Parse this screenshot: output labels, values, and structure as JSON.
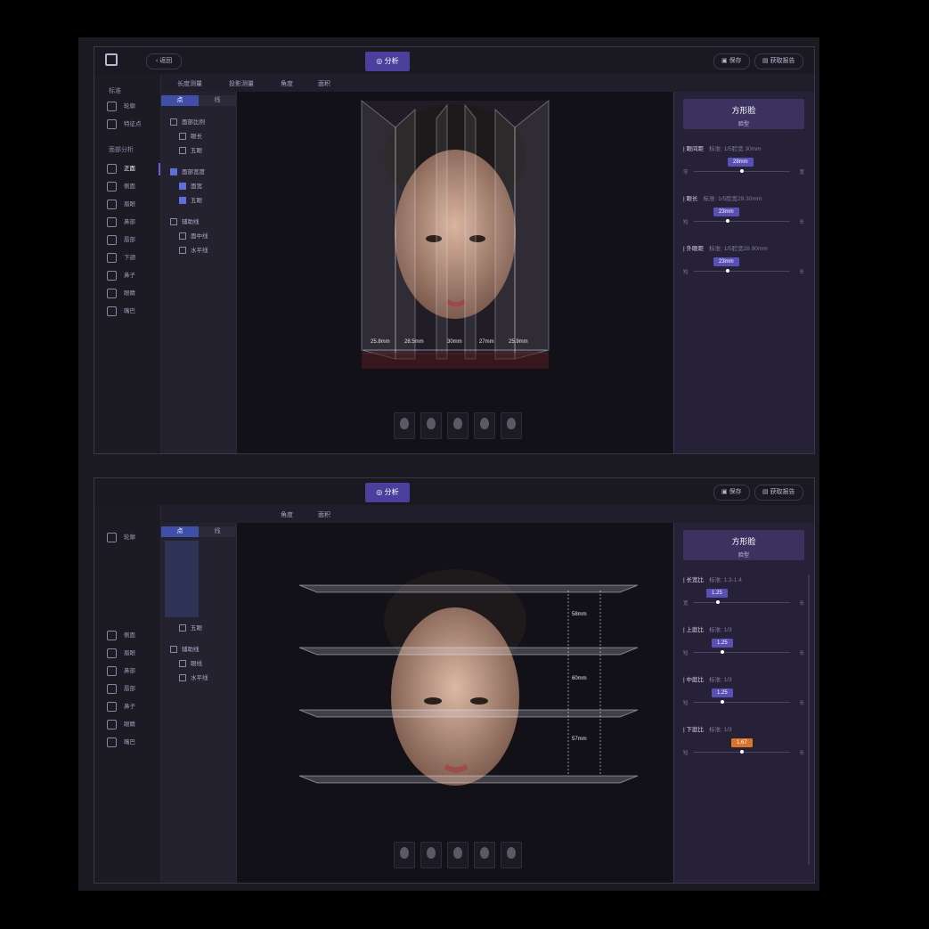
{
  "colors": {
    "accent": "#4a3f9a",
    "active_seg": "#3f4fa8",
    "warning": "#d8752a"
  },
  "top": {
    "back_label": "返回",
    "tabs": [
      {
        "label": "分析",
        "active": true
      },
      {
        "label": "",
        "active": false
      },
      {
        "label": "",
        "active": false
      },
      {
        "label": "",
        "active": false
      }
    ],
    "save_label": "保存",
    "report_label": "获取报告",
    "tools": [
      "长度测量",
      "投影测量",
      "角度",
      "面积"
    ],
    "nav_group_1": "标准",
    "nav_items_1": [
      "轮廓",
      "特征点"
    ],
    "nav_group_2": "面部分析",
    "nav_items_2": [
      "正面",
      "侧面",
      "眉眼",
      "鼻部",
      "唇部",
      "下颌",
      "鼻子",
      "眼睛",
      "嘴巴"
    ],
    "seg": [
      "点",
      "线"
    ],
    "options": [
      {
        "label": "面部比例",
        "checked": false
      },
      {
        "label": "眼长",
        "checked": false
      },
      {
        "label": "五眼",
        "checked": false
      },
      {
        "label": "面部宽度",
        "checked": true
      },
      {
        "label": "面宽",
        "checked": true
      },
      {
        "label": "五眼",
        "checked": true
      },
      {
        "label": "辅助线",
        "checked": false
      },
      {
        "label": "面中线",
        "checked": false
      },
      {
        "label": "水平线",
        "checked": false
      }
    ],
    "measures": [
      "25.8mm",
      "28.5mm",
      "30mm",
      "27mm",
      "25.9mm"
    ],
    "face_type": "方形脸",
    "face_sub": "脸型",
    "metrics": [
      {
        "label": "眼间距",
        "std": "标准: 1/5脸宽 30mm",
        "value": "28mm",
        "knob": 0.5,
        "lo": "窄",
        "hi": "宽"
      },
      {
        "label": "眼长",
        "std": "标准: 1/5脸宽29.30mm",
        "value": "23mm",
        "knob": 0.35,
        "lo": "短",
        "hi": "长"
      },
      {
        "label": "外眼距",
        "std": "标准: 1/5脸宽28.90mm",
        "value": "23mm",
        "knob": 0.35,
        "lo": "短",
        "hi": "长"
      }
    ]
  },
  "bottom": {
    "tabs": [
      {
        "label": "分析",
        "active": true
      },
      {
        "label": "",
        "active": false
      },
      {
        "label": "",
        "active": false
      },
      {
        "label": "",
        "active": false
      }
    ],
    "save_label": "保存",
    "report_label": "获取报告",
    "tools": [
      "角度",
      "面积"
    ],
    "nav_items": [
      "轮廓",
      "",
      "侧面",
      "眉眼",
      "鼻部",
      "唇部",
      "鼻子",
      "眼睛",
      "嘴巴"
    ],
    "seg": [
      "点",
      "线"
    ],
    "options": [
      {
        "label": "五眼",
        "checked": false
      },
      {
        "label": "辅助线",
        "checked": false
      },
      {
        "label": "眼线",
        "checked": false
      },
      {
        "label": "水平线",
        "checked": false
      }
    ],
    "measures": [
      "58mm",
      "60mm",
      "57mm"
    ],
    "face_type": "方形脸",
    "face_sub": "脸型",
    "metrics": [
      {
        "label": "长宽比",
        "std": "标准: 1.3-1.4",
        "value": "1.25",
        "knob": 0.25,
        "lo": "宽",
        "hi": "长",
        "warn": false
      },
      {
        "label": "上庭比",
        "std": "标准: 1/3",
        "value": "1.25",
        "knob": 0.3,
        "lo": "短",
        "hi": "长",
        "warn": false
      },
      {
        "label": "中庭比",
        "std": "标准: 1/3",
        "value": "1.25",
        "knob": 0.3,
        "lo": "短",
        "hi": "长",
        "warn": false
      },
      {
        "label": "下庭比",
        "std": "标准: 1/3",
        "value": "1.67",
        "knob": 0.5,
        "lo": "短",
        "hi": "长",
        "warn": true
      }
    ]
  }
}
